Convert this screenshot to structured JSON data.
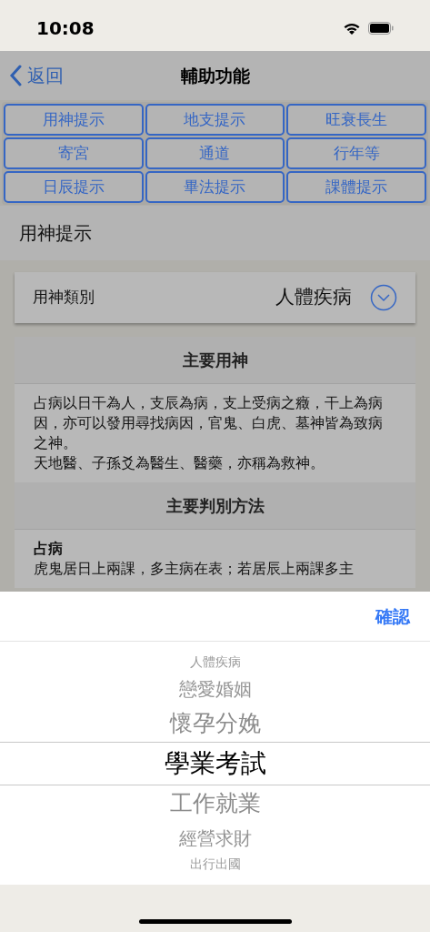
{
  "status_bar": {
    "time": "10:08"
  },
  "nav": {
    "back": "返回",
    "title": "輔助功能"
  },
  "tabs": [
    {
      "label": "用神提示"
    },
    {
      "label": "地支提示"
    },
    {
      "label": "旺衰長生"
    },
    {
      "label": "寄宮"
    },
    {
      "label": "通道"
    },
    {
      "label": "行年等"
    },
    {
      "label": "日辰提示"
    },
    {
      "label": "畢法提示"
    },
    {
      "label": "課體提示"
    }
  ],
  "section_title": "用神提示",
  "category": {
    "label": "用神類別",
    "value": "人體疾病"
  },
  "sections": [
    {
      "heading": "主要用神",
      "paragraphs": [
        "占病以日干為人，支辰為病，支上受病之癥，干上為病因，亦可以發用尋找病因，官鬼、白虎、墓神皆為致病之神。",
        "天地醫、子孫爻為醫生、醫藥，亦稱為救神。"
      ]
    },
    {
      "heading": "主要判別方法",
      "subheading": "占病",
      "paragraphs": [
        "虎鬼居日上兩課，多主病在表；若居辰上兩課多主"
      ]
    }
  ],
  "picker": {
    "confirm": "確認",
    "options": [
      {
        "label": "人體疾病",
        "selected": false
      },
      {
        "label": "戀愛婚姻",
        "selected": false
      },
      {
        "label": "懷孕分娩",
        "selected": false
      },
      {
        "label": "學業考試",
        "selected": true
      },
      {
        "label": "工作就業",
        "selected": false
      },
      {
        "label": "經營求財",
        "selected": false
      },
      {
        "label": "出行出國",
        "selected": false
      }
    ]
  }
}
